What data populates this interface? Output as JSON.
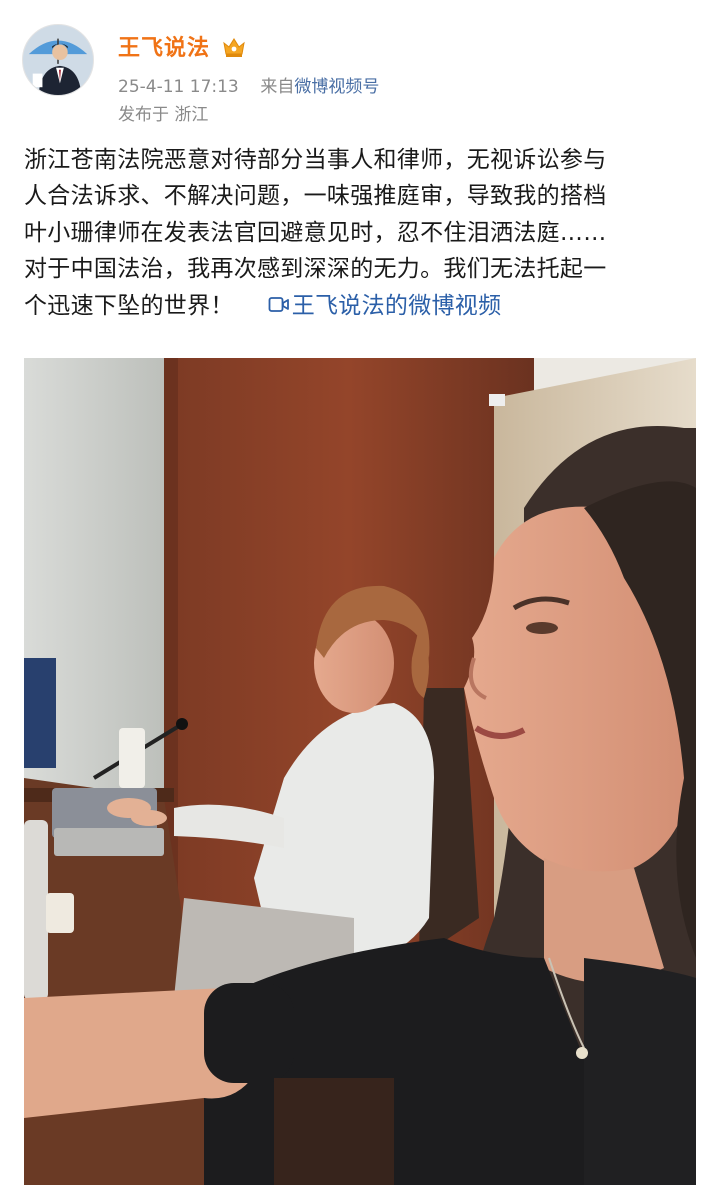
{
  "author": {
    "name": "王飞说法",
    "avatar_icon": "avatar-man-with-umbrella",
    "badge_icon": "vip-crown-icon"
  },
  "meta": {
    "time": "25-4-11 17:13",
    "source_prefix": "来自",
    "source": "微博视频号",
    "location": "发布于  浙江"
  },
  "post": {
    "lines": [
      "浙江苍南法院恶意对待部分当事人和律师，无视诉讼参与",
      "人合法诉求、不解决问题，一味强推庭审，导致我的搭档",
      "叶小珊律师在发表法官回避意见时，忍不住泪洒法庭……",
      "对于中国法治，我再次感到深深的无力。我们无法托起一",
      "个迅速下坠的世界！"
    ],
    "video_link": "王飞说法的微博视频",
    "video_icon": "video-play-icon"
  },
  "media": {
    "type": "video-thumbnail"
  },
  "colors": {
    "username": "#f07316",
    "link": "#2b5fa8",
    "meta": "#8a8a8a"
  }
}
